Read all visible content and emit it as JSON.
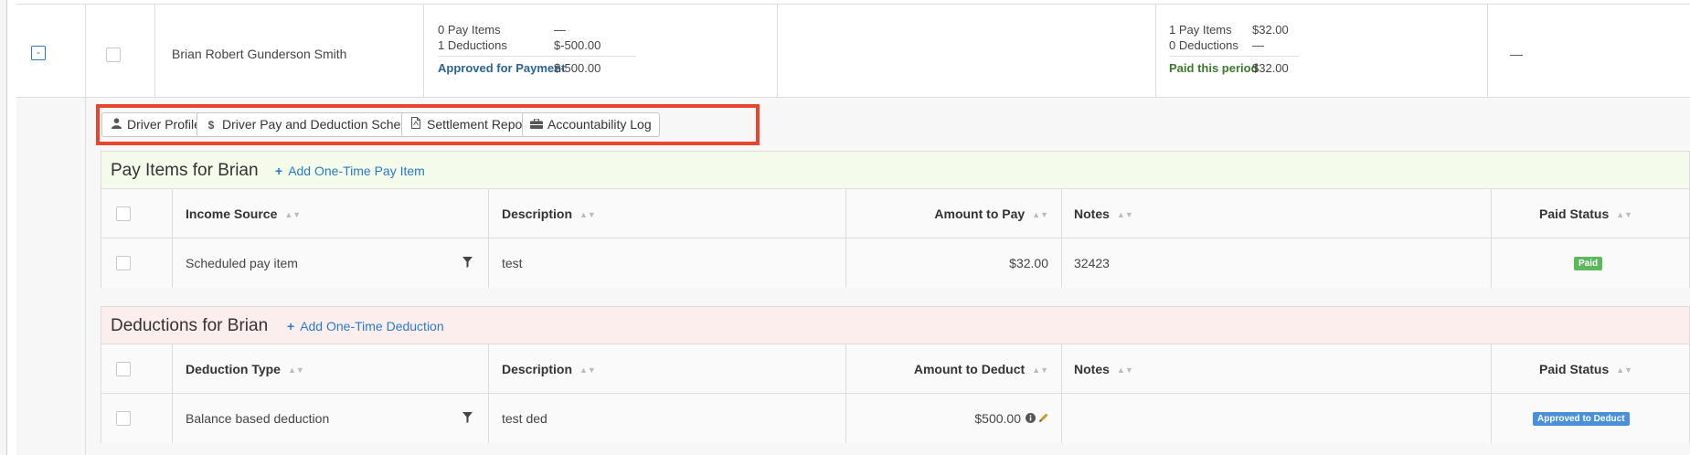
{
  "summary": {
    "expand_symbol": "-",
    "driver_name": "Brian Robert Gunderson Smith",
    "deductions_col": {
      "pay_items_label": "0 Pay Items",
      "pay_items_value": "—",
      "deductions_label": "1 Deductions",
      "deductions_value": "$-500.00",
      "status_label": "Approved for Payment",
      "status_value": "$-500.00"
    },
    "paid_col": {
      "pay_items_label": "1 Pay Items",
      "pay_items_value": "$32.00",
      "deductions_label": "0 Deductions",
      "deductions_value": "—",
      "status_label": "Paid this period",
      "status_value": "$32.00"
    },
    "last_col_value": "—"
  },
  "toolbar": {
    "driver_profile": "Driver Profile",
    "pay_schedule": "Driver Pay and Deduction Schedule",
    "settlement_report": "Settlement Report",
    "accountability_log": "Accountability Log",
    "icons": [
      "user-icon",
      "dollar-icon",
      "pdf-icon",
      "briefcase-icon"
    ]
  },
  "pay_items": {
    "title": "Pay Items for Brian",
    "add_link": "Add One-Time Pay Item",
    "columns": [
      "Income Source",
      "Description",
      "Amount to Pay",
      "Notes",
      "Paid Status"
    ],
    "rows": [
      {
        "source": "Scheduled pay item",
        "description": "test",
        "amount": "$32.00",
        "notes": "32423",
        "status": "Paid",
        "status_color": "#5cb85c"
      }
    ]
  },
  "deductions": {
    "title": "Deductions for Brian",
    "add_link": "Add One-Time Deduction",
    "columns": [
      "Deduction Type",
      "Description",
      "Amount to Deduct",
      "Notes",
      "Paid Status"
    ],
    "rows": [
      {
        "type": "Balance based deduction",
        "description": "test ded",
        "amount": "$500.00",
        "notes": "",
        "status": "Approved to Deduct",
        "status_color": "#4a90d9"
      }
    ]
  },
  "colors": {
    "highlight": "#e8452d",
    "link": "#2a7ac7",
    "approved": "#2a6496",
    "paid": "#3a7a2a"
  }
}
